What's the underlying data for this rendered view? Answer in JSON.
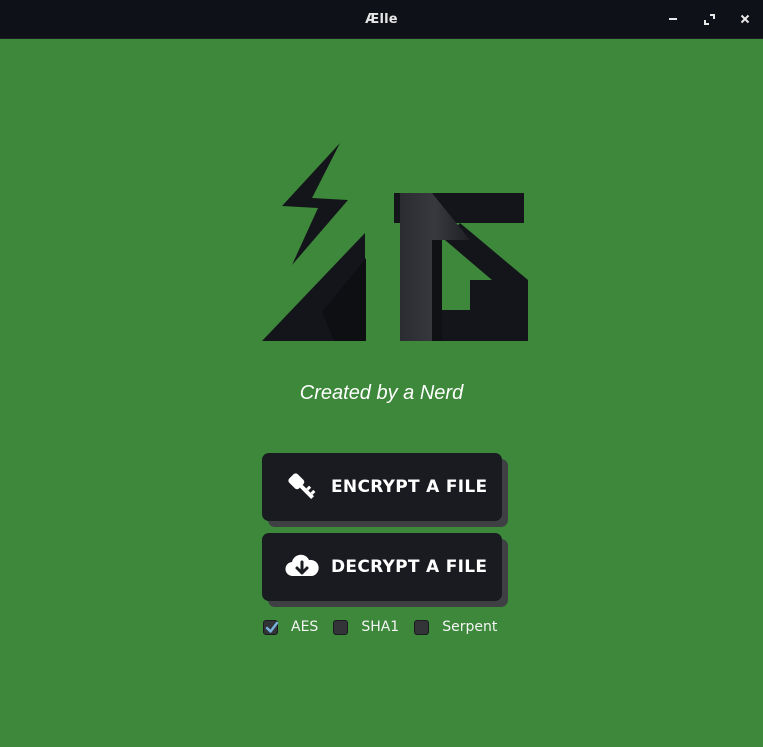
{
  "window": {
    "title": "Ælle",
    "controls": [
      "minimize-icon",
      "maximize-icon",
      "close-icon"
    ]
  },
  "app": {
    "logo_name": "aelle-logo",
    "tagline": "Created by a Nerd",
    "buttons": {
      "encrypt_label": "ENCRYPT A FILE",
      "encrypt_icon": "key-icon",
      "decrypt_label": "DECRYPT A FILE",
      "decrypt_icon": "cloud-download-icon"
    },
    "algorithms": [
      {
        "label": "AES",
        "checked": true
      },
      {
        "label": "SHA1",
        "checked": false
      },
      {
        "label": "Serpent",
        "checked": false
      }
    ]
  },
  "colors": {
    "background": "#3d883a",
    "titlebar": "#0f1118",
    "button": "#1a1b20",
    "button_shadow": "#3f4044",
    "checkmark": "#7ab3e0"
  }
}
